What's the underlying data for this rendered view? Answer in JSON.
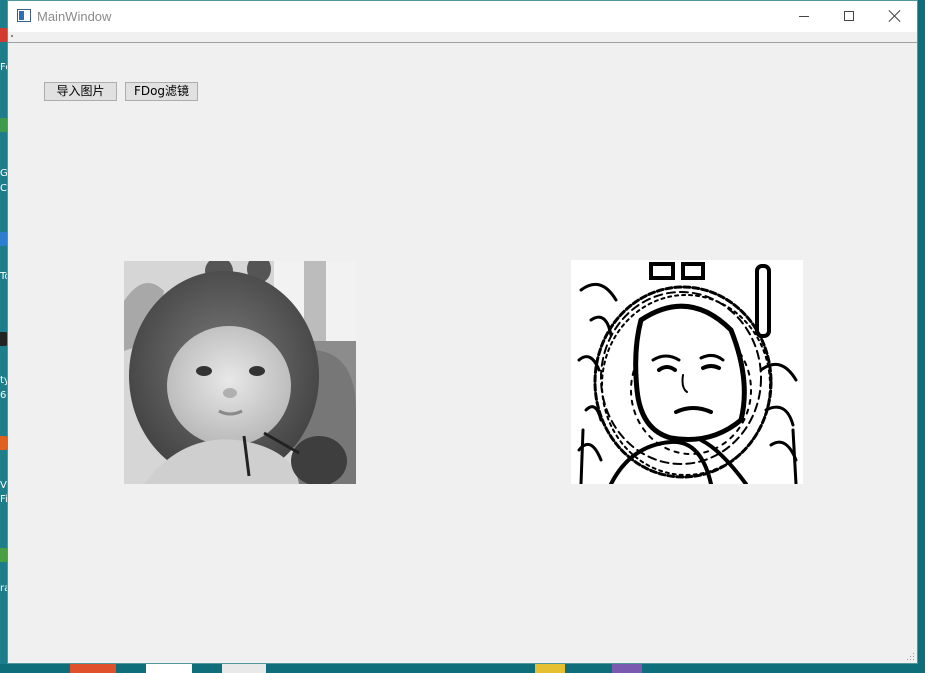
{
  "window": {
    "title": "MainWindow",
    "icons": {
      "app": "app-window-icon",
      "minimize": "minimize-icon",
      "maximize": "maximize-icon",
      "close": "close-icon"
    }
  },
  "toolbar": {
    "import_label": "导入图片",
    "filter_label": "FDog滤镜"
  },
  "images": {
    "original": "grayscale-baby-photo",
    "filtered": "fdog-line-drawing"
  },
  "desktop": {
    "left_texts": [
      "Fo",
      "Go",
      "Ch",
      "To",
      "ty",
      "6",
      "Vi",
      "Fi",
      "ra"
    ]
  },
  "colors": {
    "desktop": "#0e6f7a",
    "window_bg": "#f0f0f0",
    "titlebar": "#ffffff"
  }
}
